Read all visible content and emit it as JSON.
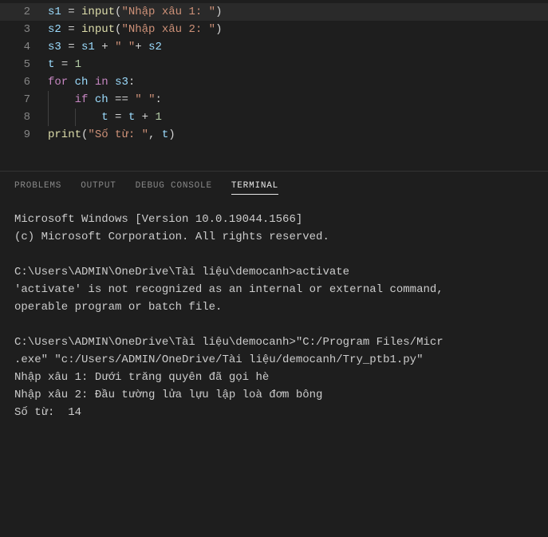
{
  "editor": {
    "lines": [
      {
        "num": "2",
        "active": true,
        "tokens": [
          {
            "t": "s1",
            "c": "var"
          },
          {
            "t": " ",
            "c": "op"
          },
          {
            "t": "=",
            "c": "op"
          },
          {
            "t": " ",
            "c": "op"
          },
          {
            "t": "input",
            "c": "fn"
          },
          {
            "t": "(",
            "c": "op"
          },
          {
            "t": "\"Nhập xâu 1: \"",
            "c": "str"
          },
          {
            "t": ")",
            "c": "op"
          }
        ]
      },
      {
        "num": "3",
        "active": false,
        "tokens": [
          {
            "t": "s2",
            "c": "var"
          },
          {
            "t": " ",
            "c": "op"
          },
          {
            "t": "=",
            "c": "op"
          },
          {
            "t": " ",
            "c": "op"
          },
          {
            "t": "input",
            "c": "fn"
          },
          {
            "t": "(",
            "c": "op"
          },
          {
            "t": "\"Nhập xâu 2: \"",
            "c": "str"
          },
          {
            "t": ")",
            "c": "op"
          }
        ]
      },
      {
        "num": "4",
        "active": false,
        "tokens": [
          {
            "t": "s3",
            "c": "var"
          },
          {
            "t": " ",
            "c": "op"
          },
          {
            "t": "=",
            "c": "op"
          },
          {
            "t": " ",
            "c": "op"
          },
          {
            "t": "s1",
            "c": "var"
          },
          {
            "t": " ",
            "c": "op"
          },
          {
            "t": "+",
            "c": "op"
          },
          {
            "t": " ",
            "c": "op"
          },
          {
            "t": "\" \"",
            "c": "str"
          },
          {
            "t": "+",
            "c": "op"
          },
          {
            "t": " ",
            "c": "op"
          },
          {
            "t": "s2",
            "c": "var"
          }
        ]
      },
      {
        "num": "5",
        "active": false,
        "tokens": [
          {
            "t": "t",
            "c": "var"
          },
          {
            "t": " ",
            "c": "op"
          },
          {
            "t": "=",
            "c": "op"
          },
          {
            "t": " ",
            "c": "op"
          },
          {
            "t": "1",
            "c": "num"
          }
        ]
      },
      {
        "num": "6",
        "active": false,
        "tokens": [
          {
            "t": "for",
            "c": "kw"
          },
          {
            "t": " ",
            "c": "op"
          },
          {
            "t": "ch",
            "c": "var"
          },
          {
            "t": " ",
            "c": "op"
          },
          {
            "t": "in",
            "c": "kw"
          },
          {
            "t": " ",
            "c": "op"
          },
          {
            "t": "s3",
            "c": "var"
          },
          {
            "t": ":",
            "c": "op"
          }
        ]
      },
      {
        "num": "7",
        "active": false,
        "indent": 1,
        "tokens": [
          {
            "t": "if",
            "c": "kw"
          },
          {
            "t": " ",
            "c": "op"
          },
          {
            "t": "ch",
            "c": "var"
          },
          {
            "t": " ",
            "c": "op"
          },
          {
            "t": "==",
            "c": "op"
          },
          {
            "t": " ",
            "c": "op"
          },
          {
            "t": "\" \"",
            "c": "str"
          },
          {
            "t": ":",
            "c": "op"
          }
        ]
      },
      {
        "num": "8",
        "active": false,
        "indent": 2,
        "tokens": [
          {
            "t": "t",
            "c": "var"
          },
          {
            "t": " ",
            "c": "op"
          },
          {
            "t": "=",
            "c": "op"
          },
          {
            "t": " ",
            "c": "op"
          },
          {
            "t": "t",
            "c": "var"
          },
          {
            "t": " ",
            "c": "op"
          },
          {
            "t": "+",
            "c": "op"
          },
          {
            "t": " ",
            "c": "op"
          },
          {
            "t": "1",
            "c": "num"
          }
        ]
      },
      {
        "num": "9",
        "active": false,
        "tokens": [
          {
            "t": "print",
            "c": "fn"
          },
          {
            "t": "(",
            "c": "op"
          },
          {
            "t": "\"Số từ: \"",
            "c": "str"
          },
          {
            "t": ",",
            "c": "op"
          },
          {
            "t": " ",
            "c": "op"
          },
          {
            "t": "t",
            "c": "var"
          },
          {
            "t": ")",
            "c": "op"
          }
        ]
      }
    ]
  },
  "panel": {
    "tabs": [
      {
        "label": "PROBLEMS",
        "active": false
      },
      {
        "label": "OUTPUT",
        "active": false
      },
      {
        "label": "DEBUG CONSOLE",
        "active": false
      },
      {
        "label": "TERMINAL",
        "active": true
      }
    ]
  },
  "terminal": {
    "blocks": [
      [
        "Microsoft Windows [Version 10.0.19044.1566]",
        "(c) Microsoft Corporation. All rights reserved."
      ],
      [
        "C:\\Users\\ADMIN\\OneDrive\\Tài liệu\\democanh>activate",
        "'activate' is not recognized as an internal or external command,",
        "operable program or batch file."
      ],
      [
        "C:\\Users\\ADMIN\\OneDrive\\Tài liệu\\democanh>\"C:/Program Files/Micr",
        ".exe\" \"c:/Users/ADMIN/OneDrive/Tài liệu/democanh/Try_ptb1.py\"",
        "Nhập xâu 1: Dưới trăng quyên đã gọi hè",
        "Nhập xâu 2: Đầu tường lửa lựu lập loà đơm bông",
        "Số từ:  14"
      ]
    ]
  }
}
